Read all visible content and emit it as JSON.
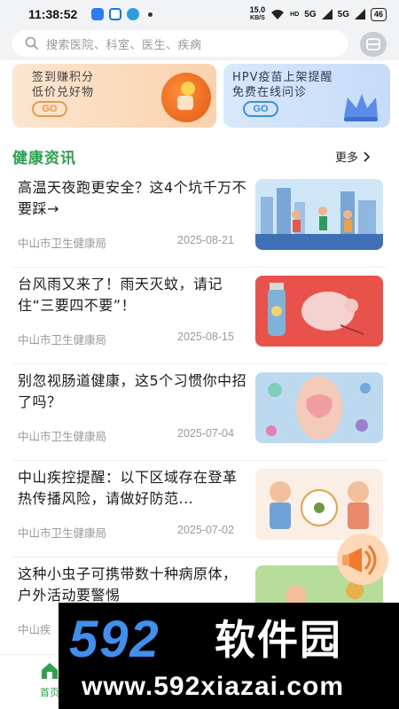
{
  "status_bar": {
    "time": "11:38:52",
    "net_speed_value": "15.0",
    "net_speed_unit": "KB/S",
    "hd_label": "HD",
    "signal1": "5G",
    "signal2": "5G",
    "battery": "46"
  },
  "search": {
    "placeholder": "搜索医院、科室、医生、疾病"
  },
  "banners": [
    {
      "line1": "签到赚积分",
      "line2": "低价兑好物",
      "go": "GO"
    },
    {
      "line1": "HPV疫苗上架提醒",
      "line2": "免费在线问诊",
      "go": "GO"
    }
  ],
  "news_section": {
    "title": "健康资讯",
    "more_label": "更多"
  },
  "news": [
    {
      "title": "高温天夜跑更安全？这4个坑千万不要踩→",
      "source": "中山市卫生健康局",
      "date": "2025-08-21"
    },
    {
      "title": "台风雨又来了！雨天灭蚊，请记住“三要四不要”！",
      "source": "中山市卫生健康局",
      "date": "2025-08-15"
    },
    {
      "title": "别忽视肠道健康，这5个习惯你中招了吗？",
      "source": "中山市卫生健康局",
      "date": "2025-07-04"
    },
    {
      "title": "中山疾控提醒：以下区域存在登革热传播风险，请做好防范...",
      "source": "中山市卫生健康局",
      "date": "2025-07-02"
    },
    {
      "title": "这种小虫子可携带数十种病原体，户外活动要警惕",
      "source": "中山疾",
      "date": ""
    }
  ],
  "bottom_nav": {
    "home_label": "首页"
  },
  "watermark": {
    "logo": "592",
    "brand": "软件园",
    "url": "www.592xiazai.com"
  },
  "colors": {
    "accent_green": "#2ba24c",
    "watermark_blue": "#3f8ff0"
  }
}
